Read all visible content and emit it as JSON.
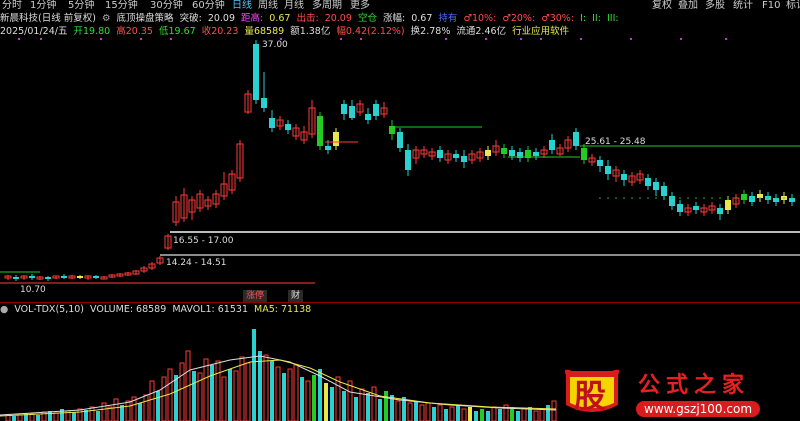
{
  "toolbar": {
    "periods": [
      "分时",
      "1分钟",
      "5分钟",
      "15分钟",
      "30分钟",
      "60分钟",
      "日线",
      "周线",
      "月线",
      "多周期",
      "更多"
    ],
    "active_period": "日线",
    "right": [
      "复权",
      "叠加",
      "多股",
      "统计",
      "F10",
      "标记"
    ]
  },
  "header": {
    "stock": "新晨科技(日线 前复权)",
    "strategy": "底顶操盘策略",
    "breakout_label": "突破:",
    "breakout_value": "20.09",
    "distance_label": "距高:",
    "distance_value": "0.67",
    "exit_label": "出击:",
    "exit_value": "20.09",
    "space_label": "空仓",
    "rise_label": "涨幅:",
    "rise_value": "0.67",
    "sig1": "持有",
    "sig2": "♂10%:",
    "sig3": "♂20%:",
    "sig4": "♂30%:",
    "sig5": "I:",
    "sig6": "II:",
    "sig7": "III:"
  },
  "quote": {
    "date": "2025/01/24/五",
    "open": "开19.80",
    "high": "高20.35",
    "low": "低19.67",
    "close": "收20.23",
    "volume": "量68589",
    "amount": "额1.38亿",
    "change": "幅0.42(2.12%)",
    "turnover": "换2.78%",
    "float": "流通2.46亿",
    "industry": "行业应用软件"
  },
  "price_labels": {
    "peak": "37.00",
    "level_right": "25.61 - 25.48",
    "level_mid": "16.55 - 17.00",
    "level_low": "14.24 - 14.51",
    "bottom": "10.70"
  },
  "tags": {
    "rise_stop": "涨停",
    "fin": "财"
  },
  "volume_panel": {
    "indicator": "VOL-TDX(5,10)",
    "volume": "VOLUME: 68589",
    "mavol1": "MAVOL1: 61531",
    "ma5": "MA5: 71138"
  },
  "watermark": {
    "logo_char": "股",
    "site_name": "公式之家",
    "url": "www.gszj100.com"
  },
  "colors": {
    "up": "#ff3b3b",
    "down": "#2ad1d1",
    "green_up": "#22cc22",
    "yellow": "#e8e84d",
    "bg": "#000000"
  }
}
